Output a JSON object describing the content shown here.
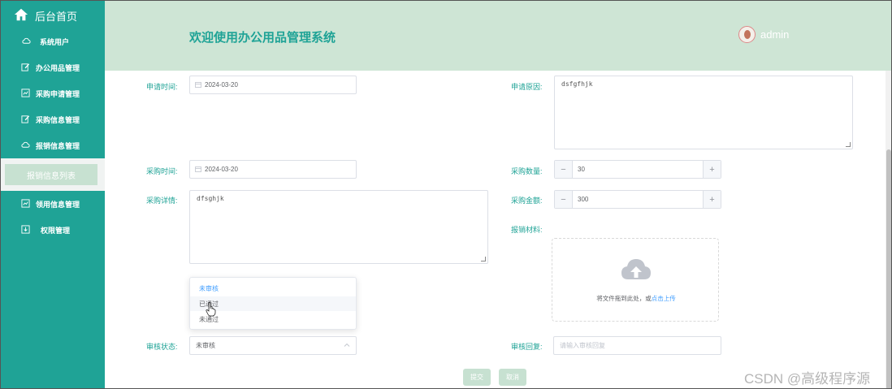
{
  "sidebar": {
    "home_label": "后台首页",
    "items": [
      {
        "label": "系统用户",
        "icon": "cloud-icon"
      },
      {
        "label": "办公用品管理",
        "icon": "edit-icon"
      },
      {
        "label": "采购申请管理",
        "icon": "chart-icon"
      },
      {
        "label": "采购信息管理",
        "icon": "edit-icon"
      },
      {
        "label": "报销信息管理",
        "icon": "cloud-icon"
      },
      {
        "label": "领用信息管理",
        "icon": "chart-icon"
      },
      {
        "label": "权限管理",
        "icon": "download-icon"
      }
    ],
    "active_sub_item": "报销信息列表"
  },
  "header": {
    "title": "欢迎使用办公用品管理系统",
    "username": "admin"
  },
  "form": {
    "apply_time_label": "申请时间:",
    "apply_time_value": "2024-03-20",
    "apply_reason_label": "申请原因:",
    "apply_reason_value": "dsfgfhjk",
    "purchase_time_label": "采购时间:",
    "purchase_time_value": "2024-03-20",
    "purchase_qty_label": "采购数量:",
    "purchase_qty_value": "30",
    "purchase_detail_label": "采购详情:",
    "purchase_detail_value": "dfsghjk",
    "purchase_amount_label": "采购金额:",
    "purchase_amount_value": "300",
    "reimburse_material_label": "报销材料:",
    "upload_text": "将文件拖到此处，或",
    "upload_link": "点击上传",
    "status_options": [
      "未审核",
      "已通过",
      "未通过"
    ],
    "audit_status_label": "审核状态:",
    "audit_status_value": "未审核",
    "audit_reply_label": "审核回复:",
    "audit_reply_placeholder": "请输入审核回复",
    "submit_label": "提交",
    "cancel_label": "取消"
  },
  "watermark": "CSDN @高级程序源",
  "colors": {
    "sidebar_bg": "#1fa396",
    "header_bg": "#cee5d5",
    "accent": "#1fa396",
    "link": "#409eff",
    "button_bg": "#c7e1d1"
  }
}
